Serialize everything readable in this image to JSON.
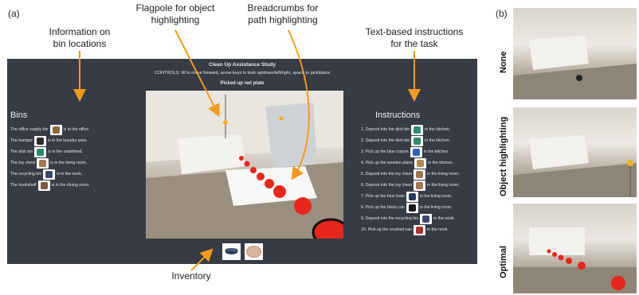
{
  "panel_a_label": "(a)",
  "panel_b_label": "(b)",
  "callouts": {
    "bins_info": [
      "Information on",
      "bin locations"
    ],
    "flagpole": [
      "Flagpole for object",
      "highlighting"
    ],
    "breadcrumbs": [
      "Breadcrumbs for",
      "path highlighting"
    ],
    "instructions": [
      "Text-based instructions",
      "for the task"
    ],
    "inventory": "Inventory"
  },
  "ui": {
    "title": "Clean Up Assistance Study",
    "controls": "CONTROLS: W to move forward, arrow keys to look up/down/left/right, space to pick/place",
    "status": "Picked up red plate",
    "bins_heading": "Bins",
    "instructions_heading": "Instructions",
    "bins": [
      {
        "pre": "The office supply bin",
        "post": "is in the office.",
        "color": "#8a6a3a"
      },
      {
        "pre": "The hamper",
        "post": "is in the laundry area.",
        "color": "#2c2c2c"
      },
      {
        "pre": "The dish bin",
        "post": "is in the undefined.",
        "color": "#2e8b6e"
      },
      {
        "pre": "The toy chest",
        "post": "is in the living room.",
        "color": "#a07850"
      },
      {
        "pre": "The recycling bin",
        "post": "is in the nook.",
        "color": "#3b4a6b"
      },
      {
        "pre": "The bookshelf",
        "post": "is in the dining room.",
        "color": "#7a5a3a"
      }
    ],
    "instructions": [
      {
        "pre": "1. Deposit into the dish bin",
        "post": "in the kitchen.",
        "color": "#2e8b6e"
      },
      {
        "pre": "2. Deposit into the dish bin",
        "post": "in the kitchen.",
        "color": "#2e8b6e"
      },
      {
        "pre": "3. Pick up the blue crayon",
        "post": "in the kitchen.",
        "color": "#3060c0"
      },
      {
        "pre": "4. Pick up the wooden plane",
        "post": "in the kitchen.",
        "color": "#b08850"
      },
      {
        "pre": "5. Deposit into the toy chest",
        "post": "in the living room.",
        "color": "#a07850"
      },
      {
        "pre": "6. Deposit into the toy chest",
        "post": "in the living room.",
        "color": "#a07850"
      },
      {
        "pre": "7. Pick up the blue bowl",
        "post": "in the living room.",
        "color": "#2a3a5a"
      },
      {
        "pre": "8. Pick up the black can",
        "post": "in the living room.",
        "color": "#1a1a1a"
      },
      {
        "pre": "9. Deposit into the recycling bin",
        "post": "in the nook.",
        "color": "#3b4a6b"
      },
      {
        "pre": "10. Pick up the crushed can",
        "post": "in the nook.",
        "color": "#b03030"
      }
    ],
    "inventory_colors": [
      "#2a3a5a",
      "#d9b49a"
    ]
  },
  "side_labels": [
    "None",
    "Object highlighting",
    "Optimal"
  ],
  "colors": {
    "ui_bg": "#373b46",
    "arrow": "#f29a1d",
    "breadcrumb": "#e8261c"
  }
}
